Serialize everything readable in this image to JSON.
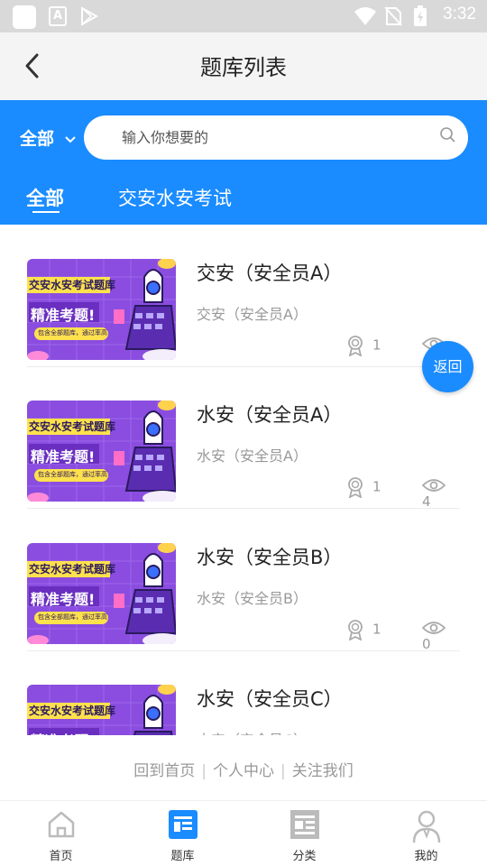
{
  "status_bar": {
    "time": "3:32",
    "a_label": "A"
  },
  "header": {
    "title": "题库列表"
  },
  "search": {
    "category": "全部",
    "placeholder": "输入你想要的"
  },
  "tabs": [
    {
      "label": "全部",
      "active": true
    },
    {
      "label": "交安水安考试",
      "active": false
    }
  ],
  "thumbnail": {
    "line1": "交安水安考试题库",
    "line2": "精准考题!",
    "line3": "包含全部题库，通过率高"
  },
  "items": [
    {
      "title": "交安（安全员A）",
      "subtitle": "交安（安全员A）",
      "cert_count": "1",
      "view_count": ""
    },
    {
      "title": "水安（安全员A）",
      "subtitle": "水安（安全员A）",
      "cert_count": "1",
      "view_count": "4"
    },
    {
      "title": "水安（安全员B）",
      "subtitle": "水安（安全员B）",
      "cert_count": "1",
      "view_count": "0"
    },
    {
      "title": "水安（安全员C）",
      "subtitle": "水安（安全员C）",
      "cert_count": "",
      "view_count": ""
    }
  ],
  "return_button": "返回",
  "footer_links": [
    "回到首页",
    "个人中心",
    "关注我们"
  ],
  "bottom_nav": [
    {
      "label": "首页",
      "icon": "home-icon",
      "active": false
    },
    {
      "label": "题库",
      "icon": "question-bank-icon",
      "active": true
    },
    {
      "label": "分类",
      "icon": "category-icon",
      "active": false
    },
    {
      "label": "我的",
      "icon": "profile-icon",
      "active": false
    }
  ],
  "colors": {
    "accent": "#1a8cff",
    "thumbnail_purple": "#8a4de0",
    "muted_text": "#999999"
  }
}
